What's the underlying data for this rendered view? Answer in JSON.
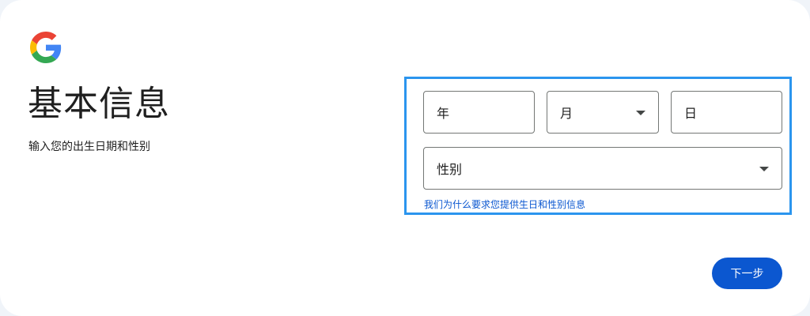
{
  "header": {
    "logo_icon": "google-g-icon",
    "title": "基本信息",
    "subtitle": "输入您的出生日期和性别"
  },
  "form": {
    "year_placeholder": "年",
    "month_label": "月",
    "day_placeholder": "日",
    "gender_label": "性别",
    "dropdown_icon": "caret-down-icon",
    "why_link": "我们为什么要求您提供生日和性别信息"
  },
  "actions": {
    "next_label": "下一步"
  },
  "colors": {
    "primary": "#0b57d0",
    "highlight_border": "#2b95ee",
    "field_border": "#747775",
    "text": "#1f1f1f",
    "google_blue": "#4285F4",
    "google_red": "#EA4335",
    "google_yellow": "#FBBC05",
    "google_green": "#34A853"
  }
}
